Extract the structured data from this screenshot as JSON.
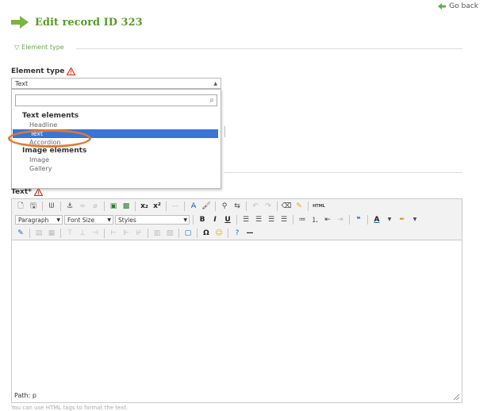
{
  "header": {
    "go_back": "Go back",
    "title": "Edit record ID 323"
  },
  "section": {
    "legend": "Element type"
  },
  "element_type": {
    "label": "Element type",
    "selected": "Text",
    "dropdown": {
      "search_value": "",
      "groups": [
        {
          "label": "Text elements",
          "options": [
            "Headline",
            "Text",
            "Accordion"
          ]
        },
        {
          "label": "Image elements",
          "options": [
            "Image",
            "Gallery"
          ]
        }
      ],
      "highlighted": "Text"
    }
  },
  "text_field": {
    "label": "Text*",
    "path": "Path: p",
    "hint": "You can use HTML tags to format the text."
  },
  "toolbar": {
    "paragraph": "Paragraph",
    "font_size": "Font Size",
    "styles": "Styles",
    "html_label": "HTML"
  },
  "colors": {
    "accent_green": "#5a9a2a",
    "selection_blue": "#3875d7",
    "highlight_orange": "#e5782b",
    "warning_red": "#d9341f"
  }
}
